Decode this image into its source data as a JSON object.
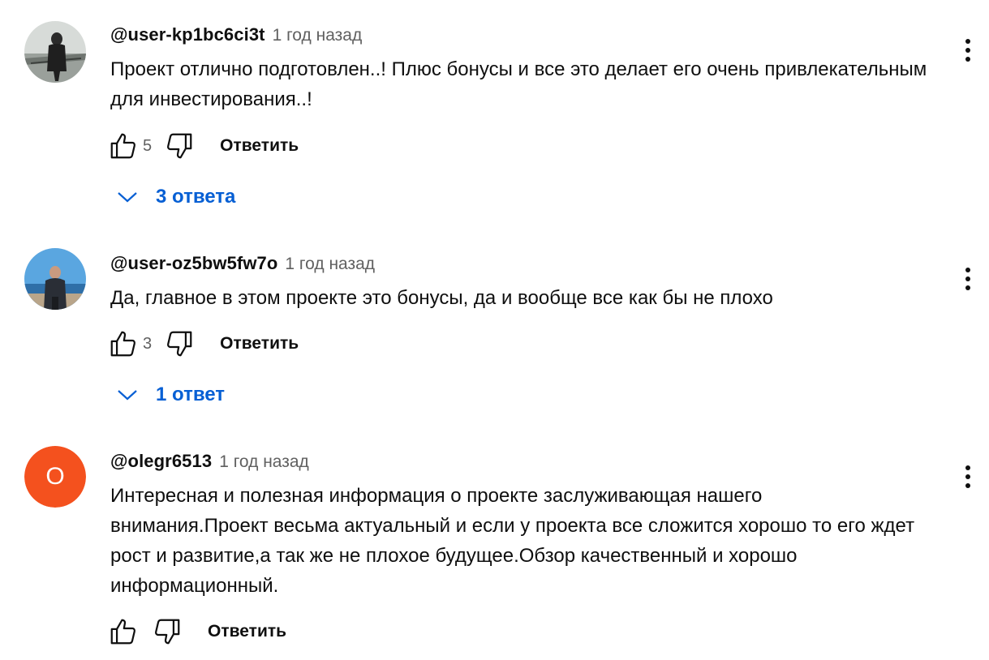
{
  "colors": {
    "link_blue": "#065fd4",
    "meta_gray": "#606060",
    "avatar_orange": "#f4511e"
  },
  "comments": [
    {
      "author": "@user-kp1bc6ci3t",
      "time": "1 год назад",
      "text": "Проект отлично подготовлен..! Плюс бонусы и все это делает его очень привлекательным для инвестирования..!",
      "likes": "5",
      "reply_label": "Ответить",
      "replies_label": "3 ответа",
      "avatar_icon": "photo-avatar"
    },
    {
      "author": "@user-oz5bw5fw7o",
      "time": "1 год назад",
      "text": "Да, главное в этом проекте это бонусы, да и вообще все как бы не плохо",
      "likes": "3",
      "reply_label": "Ответить",
      "replies_label": "1 ответ",
      "avatar_icon": "photo-avatar"
    },
    {
      "author": "@olegr6513",
      "time": "1 год назад",
      "text": "Интересная и полезная информация о проекте заслуживающая нашего внимания.Проект весьма актуальный и если у проекта все сложится хорошо то его ждет рост и развитие,а так же не плохое будущее.Обзор качественный и хорошо информационный.",
      "likes": "",
      "reply_label": "Ответить",
      "avatar_letter": "O",
      "avatar_icon": "letter-avatar"
    }
  ]
}
